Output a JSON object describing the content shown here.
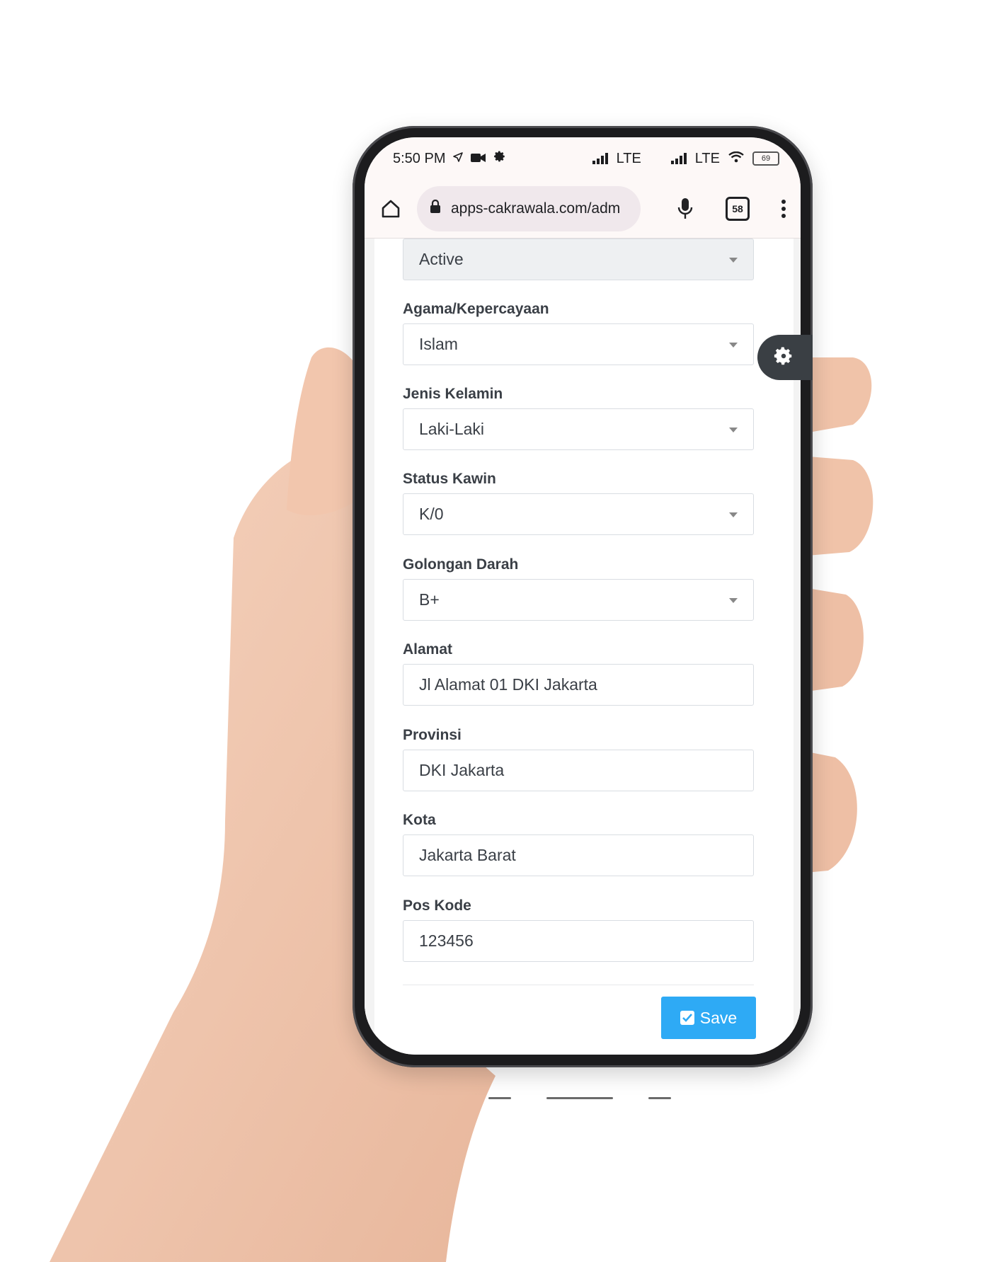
{
  "status_bar": {
    "time": "5:50 PM",
    "sim1": "LTE",
    "sim2": "LTE",
    "battery": "69"
  },
  "browser": {
    "url": "apps-cakrawala.com/adm",
    "tab_count": "58"
  },
  "form": {
    "status": {
      "value": "Active"
    },
    "religion": {
      "label": "Agama/Kepercayaan",
      "value": "Islam"
    },
    "gender": {
      "label": "Jenis Kelamin",
      "value": "Laki-Laki"
    },
    "marital": {
      "label": "Status Kawin",
      "value": "K/0"
    },
    "blood": {
      "label": "Golongan Darah",
      "value": "B+"
    },
    "address": {
      "label": "Alamat",
      "value": "Jl Alamat 01 DKI Jakarta"
    },
    "province": {
      "label": "Provinsi",
      "value": "DKI Jakarta"
    },
    "city": {
      "label": "Kota",
      "value": "Jakarta Barat"
    },
    "postal": {
      "label": "Pos Kode",
      "value": "123456"
    },
    "save_label": "Save"
  },
  "colors": {
    "accent": "#2eaaf5",
    "phone_frame": "#1c1c1e",
    "fab": "#3a3f44"
  }
}
